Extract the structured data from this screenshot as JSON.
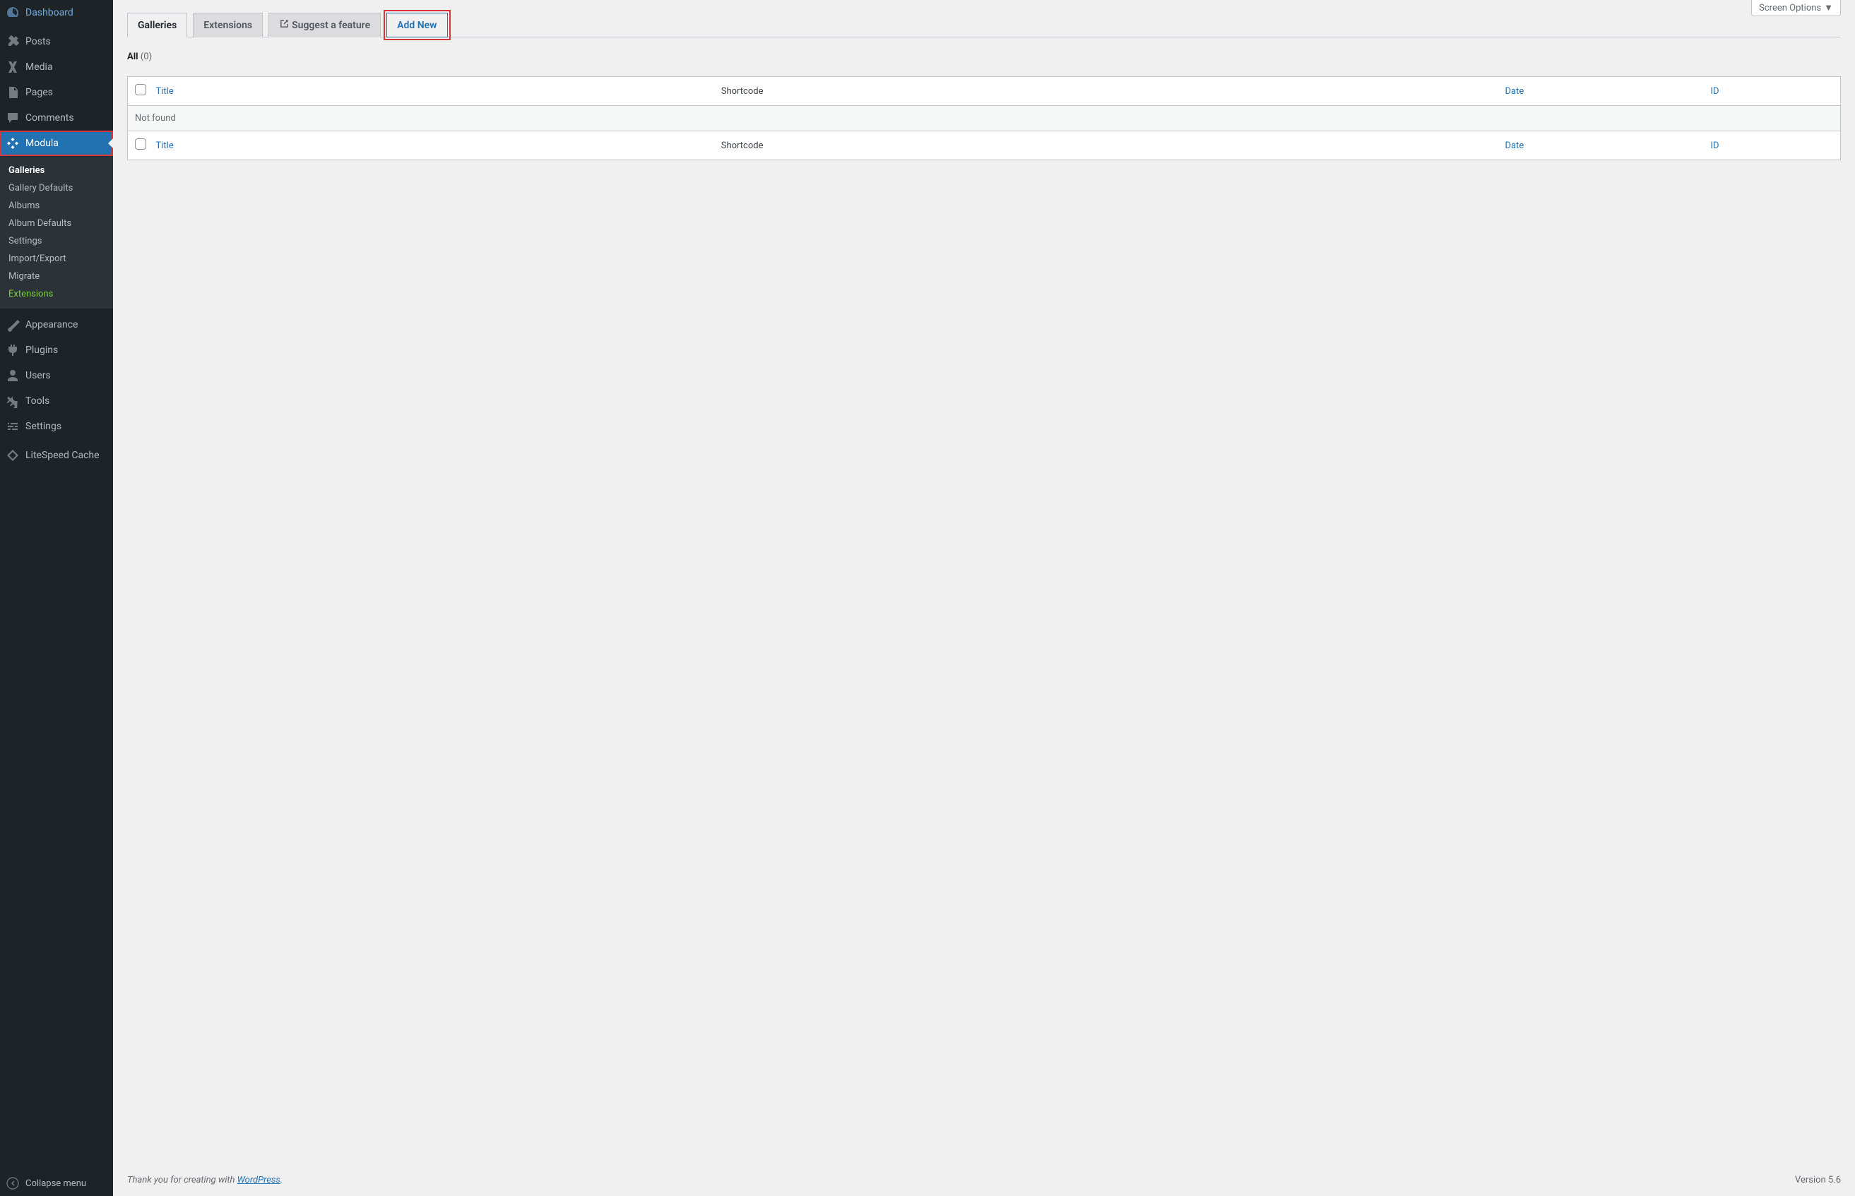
{
  "sidebar": {
    "items": [
      {
        "icon": "dashboard",
        "label": "Dashboard"
      },
      {
        "icon": "posts",
        "label": "Posts"
      },
      {
        "icon": "media",
        "label": "Media"
      },
      {
        "icon": "pages",
        "label": "Pages"
      },
      {
        "icon": "comments",
        "label": "Comments"
      },
      {
        "icon": "modula",
        "label": "Modula"
      },
      {
        "icon": "appearance",
        "label": "Appearance"
      },
      {
        "icon": "plugins",
        "label": "Plugins"
      },
      {
        "icon": "users",
        "label": "Users"
      },
      {
        "icon": "tools",
        "label": "Tools"
      },
      {
        "icon": "settings",
        "label": "Settings"
      },
      {
        "icon": "litespeed",
        "label": "LiteSpeed Cache"
      }
    ],
    "submenu": [
      {
        "label": "Galleries",
        "current": true
      },
      {
        "label": "Gallery Defaults"
      },
      {
        "label": "Albums"
      },
      {
        "label": "Album Defaults"
      },
      {
        "label": "Settings"
      },
      {
        "label": "Import/Export"
      },
      {
        "label": "Migrate"
      },
      {
        "label": "Extensions",
        "green": true
      }
    ],
    "collapse": "Collapse menu"
  },
  "screenOptions": "Screen Options",
  "tabs": {
    "galleries": "Galleries",
    "extensions": "Extensions",
    "suggest": "Suggest a feature",
    "addNew": "Add New"
  },
  "filter": {
    "all": "All",
    "count": "(0)"
  },
  "table": {
    "headers": {
      "title": "Title",
      "shortcode": "Shortcode",
      "date": "Date",
      "id": "ID"
    },
    "empty": "Not found"
  },
  "footer": {
    "thanks_prefix": "Thank you for creating with ",
    "thanks_link": "WordPress",
    "version": "Version 5.6"
  }
}
